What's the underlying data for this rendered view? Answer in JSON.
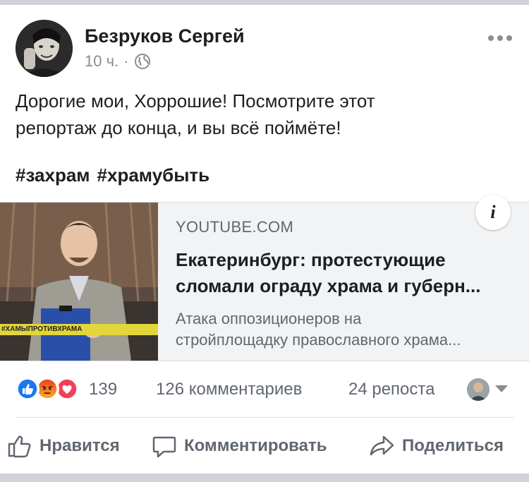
{
  "post": {
    "author": "Безруков Сергей",
    "time": "10 ч.",
    "separator": "·",
    "text_line1": "Дорогие мои, Хоррошие! Посмотрите этот",
    "text_line2": "репортаж до конца, и вы всё поймёте!",
    "hashtags": [
      "#захрам",
      "#храмубыть"
    ]
  },
  "link": {
    "domain": "YOUTUBE.COM",
    "title_line1": "Екатеринбург: протестующие",
    "title_line2": "сломали ограду храма и губерн...",
    "desc_line1": "Атака оппозиционеров на",
    "desc_line2": "стройплощадку православного храма...",
    "thumb_tag": "#ХАМЫПРОТИВХРАМА",
    "info_glyph": "i"
  },
  "stats": {
    "reactions_count": "139",
    "comments": "126 комментариев",
    "shares": "24 репоста",
    "reactions": [
      "like",
      "angry",
      "love"
    ]
  },
  "actions": {
    "like": "Нравится",
    "comment": "Комментировать",
    "share": "Поделиться"
  },
  "colors": {
    "like_blue": "#1877f2",
    "angry_orange": "#f0761d",
    "love_red": "#f33e58",
    "thumb_tag_yellow": "#e3d63a"
  }
}
